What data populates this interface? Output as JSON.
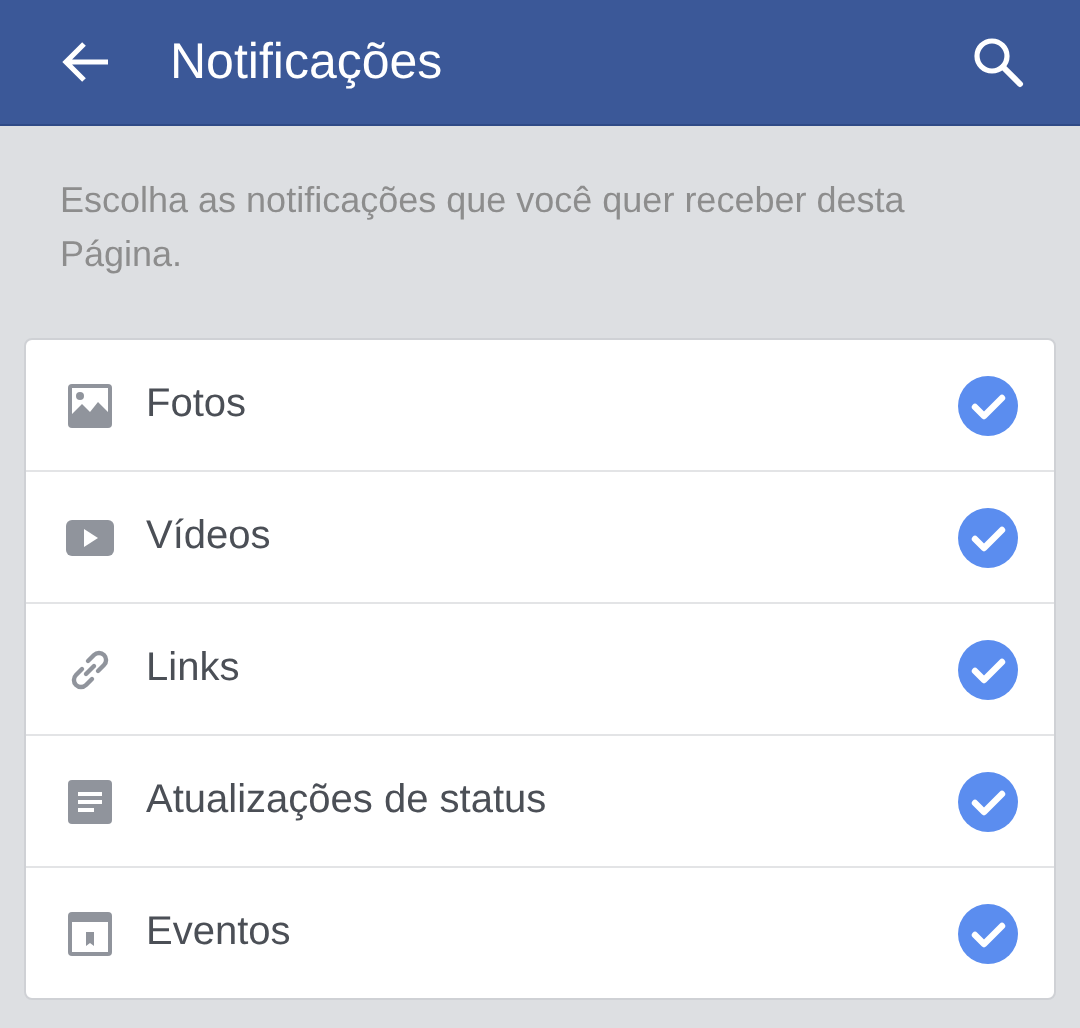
{
  "header": {
    "title": "Notificações"
  },
  "description": "Escolha as notificações que você quer receber desta Página.",
  "items": [
    {
      "kind": "photo",
      "label": "Fotos",
      "checked": true
    },
    {
      "kind": "video",
      "label": "Vídeos",
      "checked": true
    },
    {
      "kind": "link",
      "label": "Links",
      "checked": true
    },
    {
      "kind": "status",
      "label": "Atualizações de status",
      "checked": true
    },
    {
      "kind": "event",
      "label": "Eventos",
      "checked": true
    }
  ]
}
